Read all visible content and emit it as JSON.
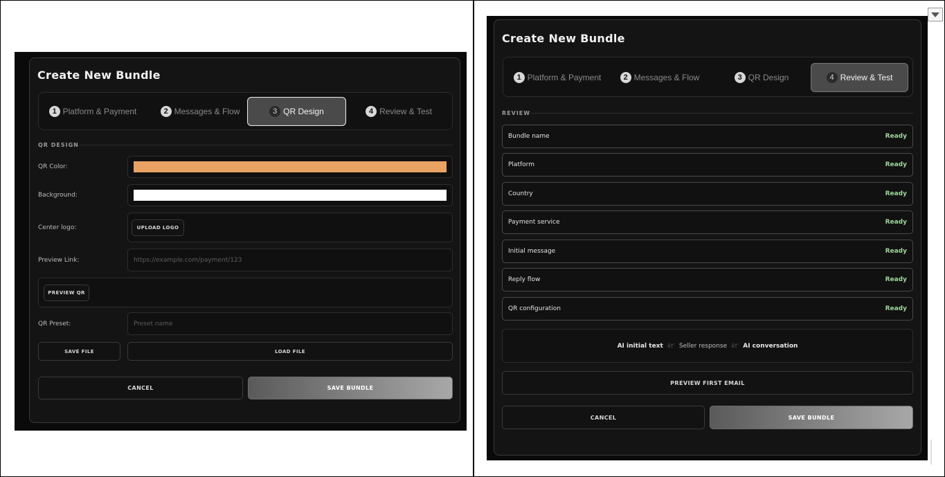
{
  "left": {
    "title": "Create New Bundle",
    "steps": [
      {
        "num": "1",
        "label": "Platform & Payment"
      },
      {
        "num": "2",
        "label": "Messages & Flow"
      },
      {
        "num": "3",
        "label": "QR Design"
      },
      {
        "num": "4",
        "label": "Review & Test"
      }
    ],
    "section": "QR DESIGN",
    "qr_color_label": "QR Color:",
    "qr_color_value": "#e9a263",
    "background_label": "Background:",
    "background_value": "#ffffff",
    "center_logo_label": "Center logo:",
    "upload_logo": "UPLOAD LOGO",
    "preview_link_label": "Preview Link:",
    "preview_link_placeholder": "https://example.com/payment/123",
    "preview_qr": "PREVIEW QR",
    "qr_preset_label": "QR Preset:",
    "qr_preset_placeholder": "Preset name",
    "save_file": "SAVE FILE",
    "load_file": "LOAD FILE",
    "cancel": "CANCEL",
    "save_bundle": "SAVE BUNDLE"
  },
  "right": {
    "title": "Create New Bundle",
    "steps": [
      {
        "num": "1",
        "label": "Platform & Payment"
      },
      {
        "num": "2",
        "label": "Messages & Flow"
      },
      {
        "num": "3",
        "label": "QR Design"
      },
      {
        "num": "4",
        "label": "Review & Test"
      }
    ],
    "section": "REVIEW",
    "review_items": [
      {
        "name": "Bundle name",
        "status": "Ready"
      },
      {
        "name": "Platform",
        "status": "Ready"
      },
      {
        "name": "Country",
        "status": "Ready"
      },
      {
        "name": "Payment service",
        "status": "Ready"
      },
      {
        "name": "Initial message",
        "status": "Ready"
      },
      {
        "name": "Reply flow",
        "status": "Ready"
      },
      {
        "name": "QR configuration",
        "status": "Ready"
      }
    ],
    "flow": {
      "step1": "AI initial text",
      "sep": "â†'",
      "step2": "Seller response",
      "step3": "AI conversation"
    },
    "preview_first_email": "PREVIEW FIRST EMAIL",
    "cancel": "CANCEL",
    "save_bundle": "SAVE BUNDLE"
  },
  "colors": {
    "ready": "#9ed69b",
    "accent_qr": "#e9a263"
  },
  "icons": [
    "chevron-down-icon"
  ]
}
